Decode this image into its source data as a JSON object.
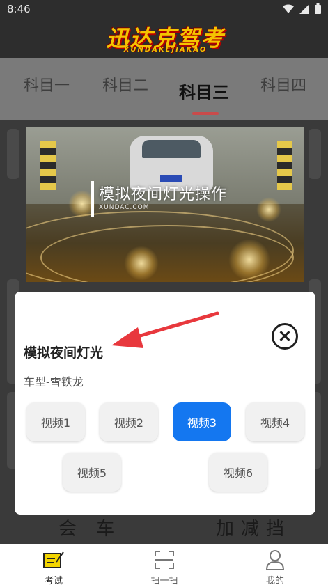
{
  "status_bar": {
    "time": "8:46"
  },
  "header": {
    "logo_main": "迅达克驾考",
    "logo_sub": "XUNDAKEJIAKAO"
  },
  "tabs": [
    {
      "label": "科目一"
    },
    {
      "label": "科目二"
    },
    {
      "label": "科目三",
      "active": true
    },
    {
      "label": "科目四"
    }
  ],
  "background": {
    "label_left": "会 车",
    "label_right": "加减挡"
  },
  "video": {
    "title": "模拟夜间灯光操作",
    "site": "XUNDAC.COM"
  },
  "modal": {
    "title": "模拟夜间灯光",
    "subtitle": "车型-雪铁龙",
    "buttons": [
      "视频1",
      "视频2",
      "视频3",
      "视频4",
      "视频5",
      "视频6"
    ],
    "selected_index": 2
  },
  "bottom_nav": [
    {
      "label": "考试",
      "icon": "exam-icon",
      "active": true
    },
    {
      "label": "扫一扫",
      "icon": "scan-icon"
    },
    {
      "label": "我的",
      "icon": "profile-icon"
    }
  ],
  "colors": {
    "accent": "#1477f0",
    "arrow": "#e8383d",
    "exam_icon": "#f2d400"
  }
}
